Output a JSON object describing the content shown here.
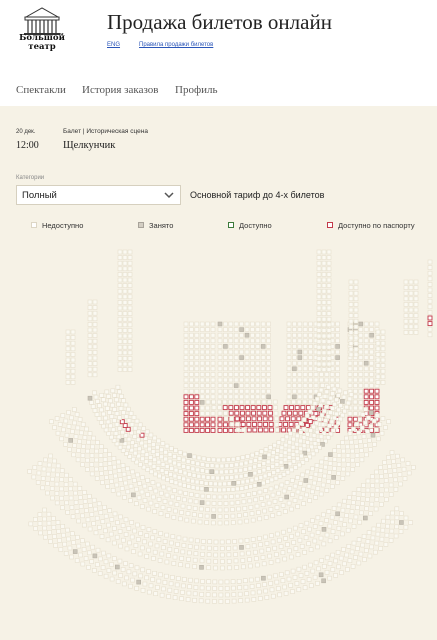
{
  "header": {
    "logo_line1": "Большой",
    "logo_line2": "театр",
    "title": "Продажа билетов онлайн",
    "lang_link": "ENG",
    "rules_link": "Правила продажи билетов"
  },
  "nav": [
    "Спектакли",
    "История заказов",
    "Профиль"
  ],
  "performance": {
    "date": "20 дек.",
    "time": "12:00",
    "category": "Балет | Историческая сцена",
    "name": "Щелкунчик"
  },
  "filter": {
    "label": "Категории",
    "selected": "Полный",
    "tariff": "Основной тариф до 4-х билетов"
  },
  "legend": [
    {
      "label": "Недоступно",
      "color": "#e8e2d2"
    },
    {
      "label": "Занято",
      "color": "#a8a39a"
    },
    {
      "label": "Доступно",
      "color": "#3d7a3a"
    },
    {
      "label": "Доступно по паспорту",
      "color": "#c23a4a"
    }
  ],
  "colors": {
    "background": "#f6f2e6",
    "seat_unavailable": "#e6dfcd",
    "seat_taken": "#c9c4b8",
    "seat_passport": "#c23a4a"
  }
}
